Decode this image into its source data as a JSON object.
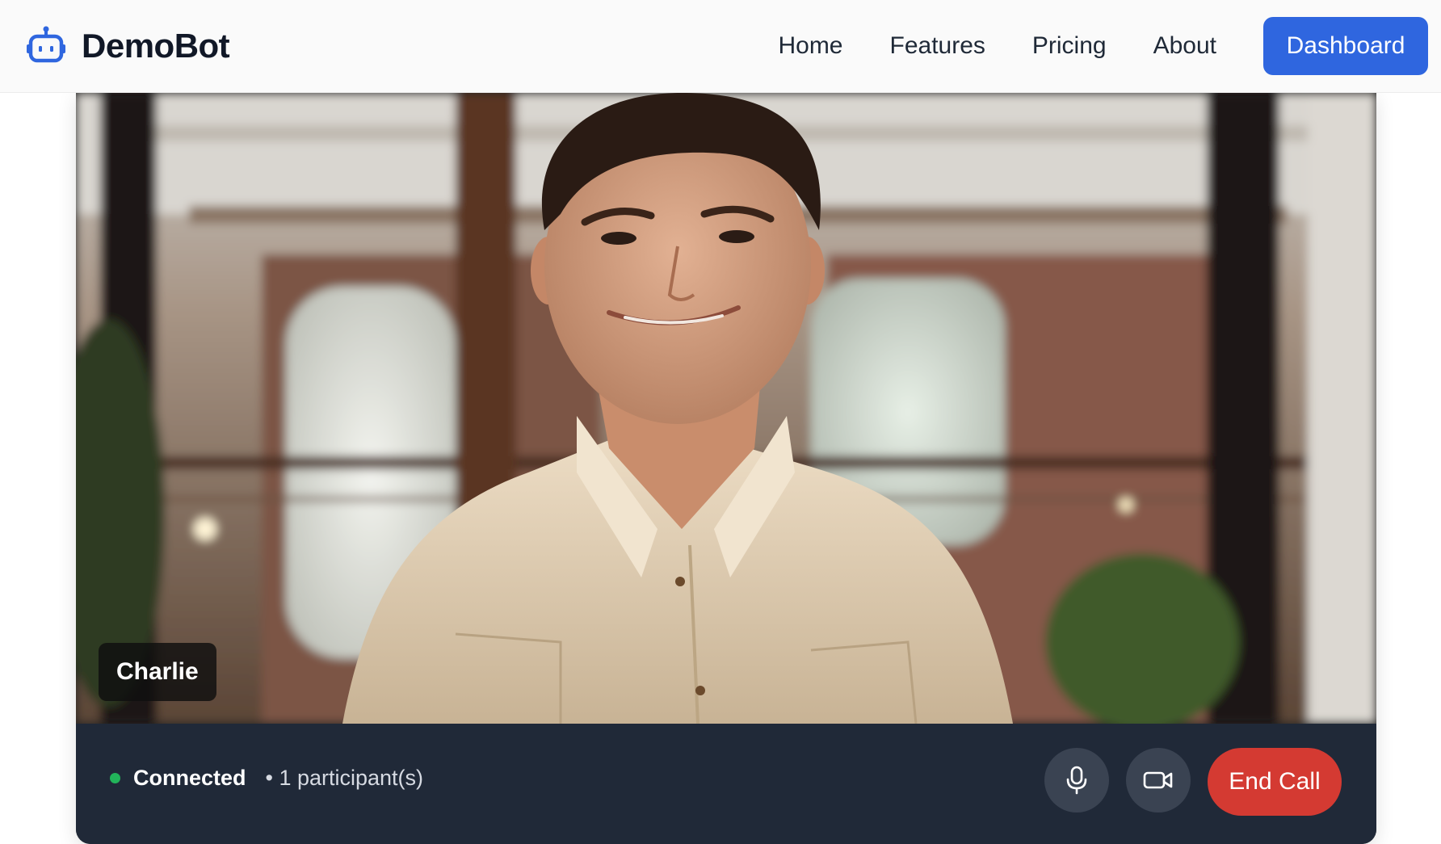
{
  "app": {
    "brand_name": "DemoBot",
    "brand_icon": "robot-icon",
    "brand_color": "#2f66df"
  },
  "nav": {
    "links": [
      "Home",
      "Features",
      "Pricing",
      "About"
    ],
    "dashboard_label": "Dashboard"
  },
  "call": {
    "participant_name": "Charlie",
    "status_label": "Connected",
    "status_color": "#22b35a",
    "participants_text": "• 1 participant(s)",
    "mic_icon": "microphone-icon",
    "camera_icon": "video-camera-icon",
    "end_call_label": "End Call",
    "end_call_color": "#d43a32"
  }
}
